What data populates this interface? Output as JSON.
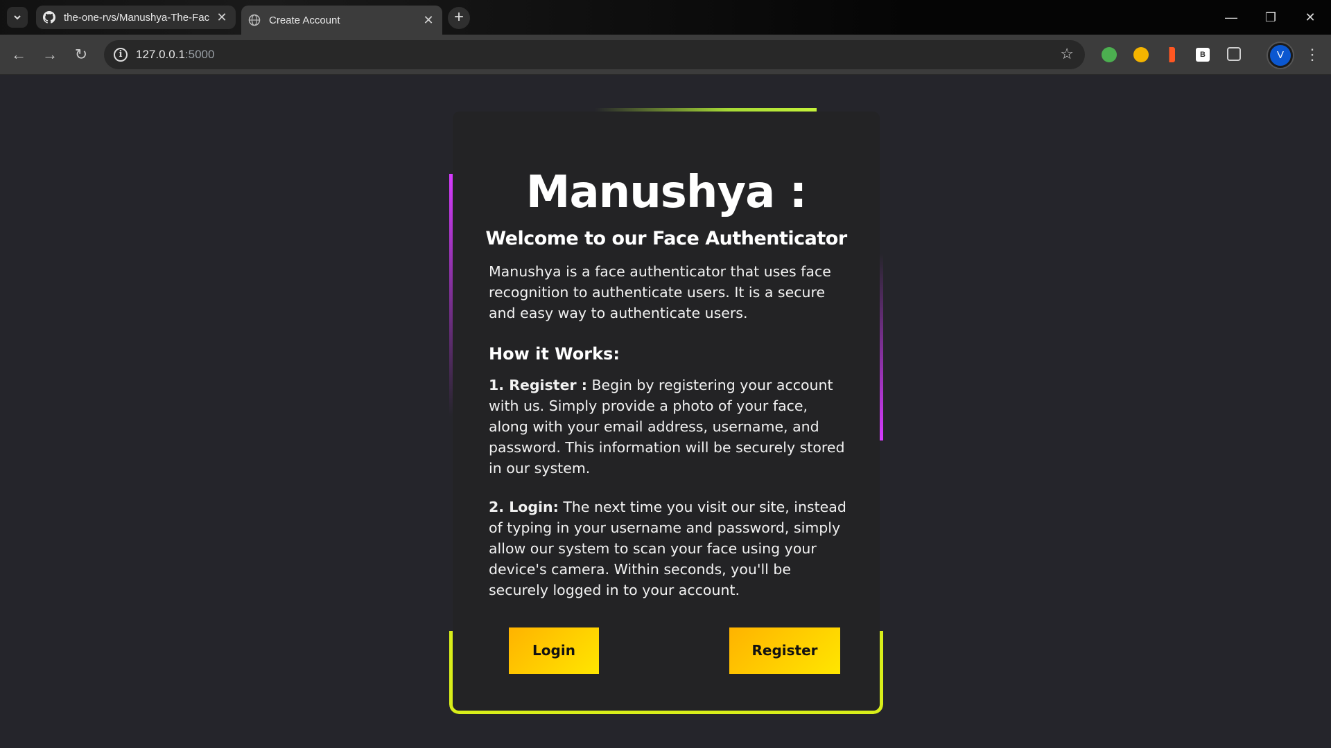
{
  "browser": {
    "tabs": [
      {
        "title": "the-one-rvs/Manushya-The-Fac",
        "favicon": "github-icon",
        "active": false
      },
      {
        "title": "Create Account",
        "favicon": "globe-icon",
        "active": true
      }
    ],
    "url_host": "127.0.0.1",
    "url_port": ":5000",
    "profile_initial": "V"
  },
  "page": {
    "title": "Manushya :",
    "subtitle": "Welcome to our Face Authenticator",
    "intro": "Manushya is a face authenticator that uses face recognition to authenticate users. It is a secure and easy way to authenticate users.",
    "how_heading": "How it Works:",
    "steps": [
      {
        "label": "1. Register :",
        "text": " Begin by registering your account with us. Simply provide a photo of your face, along with your email address, username, and password. This information will be securely stored in our system."
      },
      {
        "label": "2. Login:",
        "text": " The next time you visit our site, instead of typing in your username and password, simply allow our system to scan your face using your device's camera. Within seconds, you'll be securely logged in to your account."
      }
    ],
    "login_label": "Login",
    "register_label": "Register"
  },
  "colors": {
    "button_gradient_start": "#ffb300",
    "button_gradient_end": "#ffe600",
    "glow_green": "#c5f33a",
    "glow_purple": "#d63bff",
    "glow_yellow": "#d8ee1a",
    "background": "#25252b",
    "card": "#232325"
  }
}
